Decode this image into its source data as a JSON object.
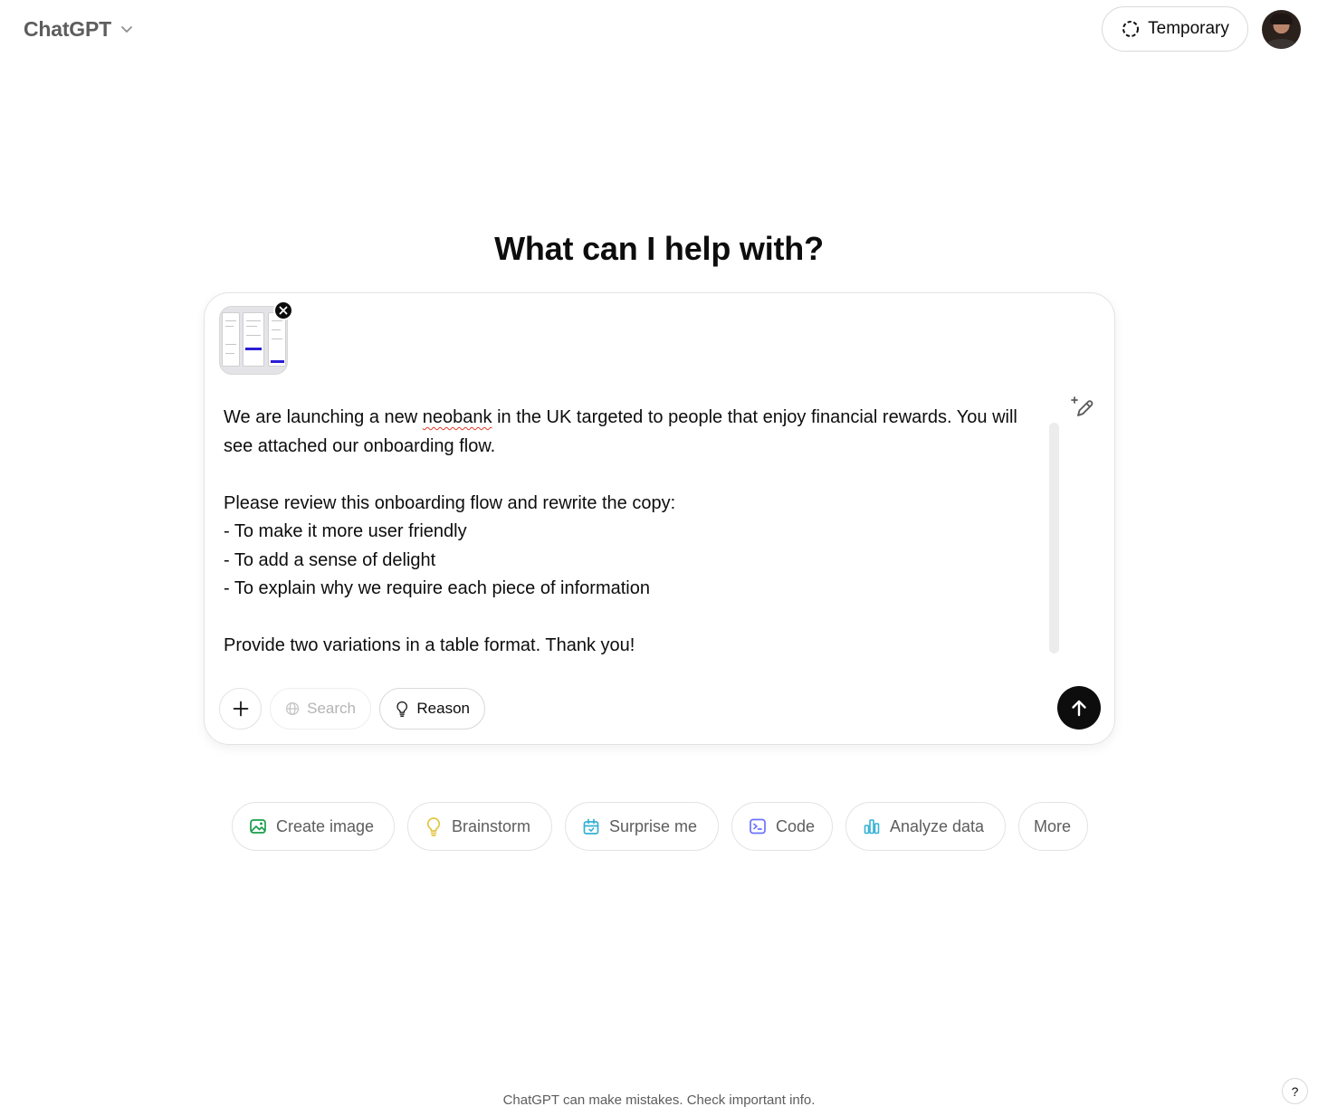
{
  "header": {
    "model_name": "ChatGPT",
    "temporary_label": "Temporary"
  },
  "main": {
    "headline": "What can I help with?"
  },
  "composer": {
    "prompt_part1": "We are launching a new ",
    "prompt_misspelled": "neobank",
    "prompt_part2": " in the UK targeted to people that enjoy financial rewards. You will see attached our onboarding flow.\n\nPlease review this onboarding flow and rewrite the copy:\n- To make it more user friendly\n- To add a sense of delight\n- To explain why we require each piece of information\n\nProvide two variations in a table format. Thank you!",
    "tools": {
      "search_label": "Search",
      "reason_label": "Reason"
    }
  },
  "suggestions": [
    {
      "label": "Create image",
      "icon": "create-image-icon",
      "color": "#1a9e4b"
    },
    {
      "label": "Brainstorm",
      "icon": "lightbulb-icon",
      "color": "#e2c541"
    },
    {
      "label": "Surprise me",
      "icon": "gift-icon",
      "color": "#35b1d4"
    },
    {
      "label": "Code",
      "icon": "code-icon",
      "color": "#6c71ff"
    },
    {
      "label": "Analyze data",
      "icon": "bar-chart-icon",
      "color": "#35b1d4"
    },
    {
      "label": "More",
      "icon": "",
      "color": ""
    }
  ],
  "footer": {
    "disclaimer": "ChatGPT can make mistakes. Check important info.",
    "help_label": "?"
  },
  "colors": {
    "send_button": "#0d0d0d",
    "muted_text": "#5d5d5d",
    "border": "#e3e3e3"
  }
}
